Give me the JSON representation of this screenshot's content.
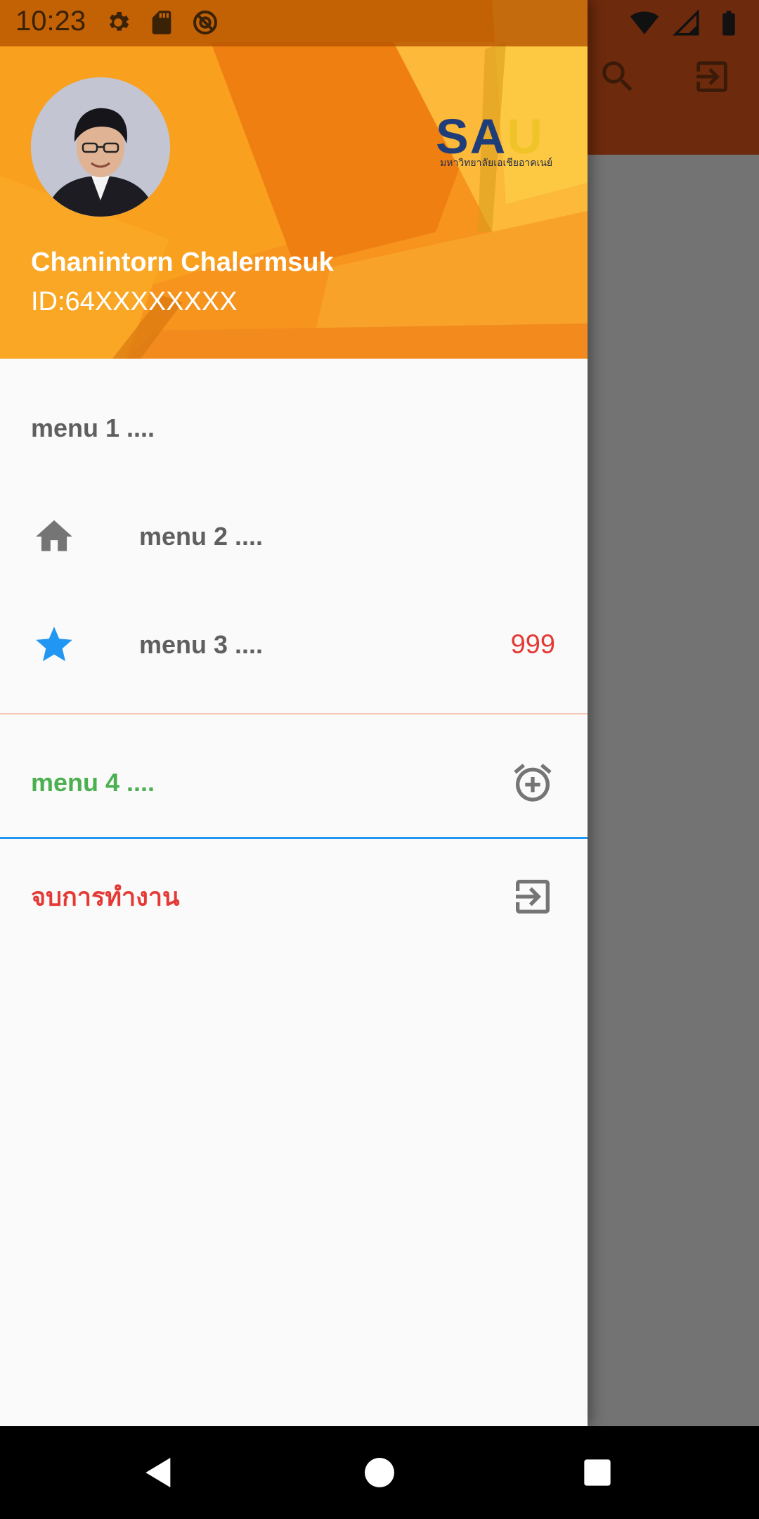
{
  "status_bar": {
    "time": "10:23",
    "left_icons": [
      "gear-icon",
      "sd-card-icon",
      "sync-icon"
    ],
    "right_icons": [
      "wifi-icon",
      "signal-icon",
      "battery-icon"
    ]
  },
  "app_bar": {
    "actions": [
      {
        "name": "search-icon"
      },
      {
        "name": "exit-to-app-icon"
      }
    ]
  },
  "drawer": {
    "header": {
      "user_name": "Chanintorn Chalermsuk",
      "user_id": "ID:64XXXXXXXX",
      "logo": {
        "text_s": "S",
        "text_a": "A",
        "text_u": "U",
        "subtitle": "มหาวิทยาลัยเอเชียอาคเนย์"
      }
    },
    "items": [
      {
        "label": "menu 1 ....",
        "color": "#5f5f5f"
      },
      {
        "label": "menu 2 ....",
        "icon": "home-icon",
        "color": "#5f5f5f"
      },
      {
        "label": "menu 3 ....",
        "icon": "star-icon",
        "badge": "999",
        "color": "#5f5f5f",
        "icon_color": "#2196f3",
        "badge_color": "#e53935"
      },
      {
        "label": "menu 4 ....",
        "trailing_icon": "alarm-add-icon",
        "color": "#4caf50"
      },
      {
        "label": "จบการทำงาน",
        "trailing_icon": "exit-to-app-icon",
        "color": "#e53935"
      }
    ]
  },
  "colors": {
    "header_orange": "#f7941d",
    "accent_blue": "#2196f3",
    "scrim": "#757575"
  },
  "nav_bar": {
    "buttons": [
      "back-icon",
      "home-circle-icon",
      "recents-icon"
    ]
  }
}
